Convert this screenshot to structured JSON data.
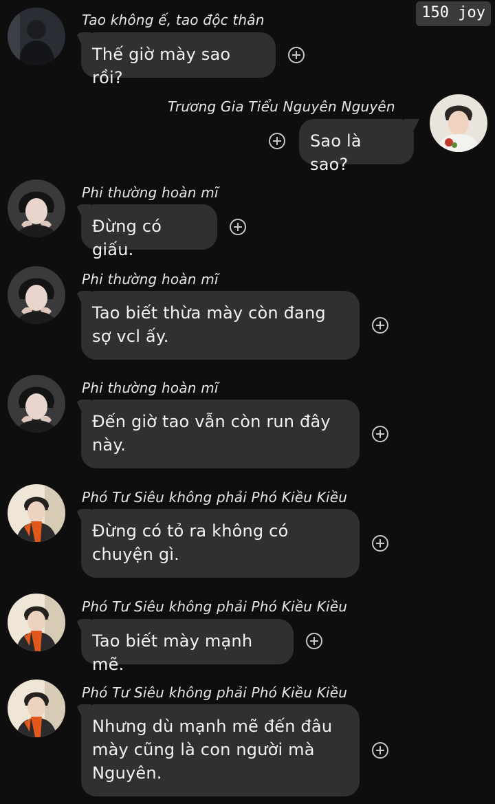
{
  "header": {
    "joy_count": "150 joy"
  },
  "messages": [
    {
      "sender": "Tao không ế, tao độc thân",
      "text": "Thế giờ mày sao rồi?",
      "side": "left",
      "avatar": "dark-hoodie-avatar"
    },
    {
      "sender": "Trương Gia Tiểu Nguyên Nguyên",
      "text": "Sao là sao?",
      "side": "right",
      "avatar": "light-portrait-avatar"
    },
    {
      "sender": "Phi thường hoàn mĩ",
      "text": "Đừng có giấu.",
      "side": "left",
      "avatar": "hands-on-face-avatar"
    },
    {
      "sender": "Phi thường hoàn mĩ",
      "text": "Tao biết thừa mày còn đang\nsợ vcl ấy.",
      "side": "left",
      "avatar": "hands-on-face-avatar"
    },
    {
      "sender": "Phi thường hoàn mĩ",
      "text": "Đến giờ tao vẫn còn run đây\nnày.",
      "side": "left",
      "avatar": "hands-on-face-avatar"
    },
    {
      "sender": "Phó Tư Siêu không phải Phó Kiều Kiều",
      "text": "Đừng có tỏ ra không có\nchuyện gì.",
      "side": "left",
      "avatar": "orange-scarf-avatar"
    },
    {
      "sender": "Phó Tư Siêu không phải Phó Kiều Kiều",
      "text": "Tao biết mày mạnh mẽ.",
      "side": "left",
      "avatar": "orange-scarf-avatar"
    },
    {
      "sender": "Phó Tư Siêu không phải Phó Kiều Kiều",
      "text": "Nhưng dù mạnh mẽ đến đâu\nmày cũng là con người mà\nNguyên.",
      "side": "left",
      "avatar": "orange-scarf-avatar"
    }
  ],
  "colors": {
    "background": "#0e0e0e",
    "bubble": "#303030",
    "text": "#f2f2f2",
    "badge": "#3a3a3a",
    "scarf": "#e0581c"
  }
}
